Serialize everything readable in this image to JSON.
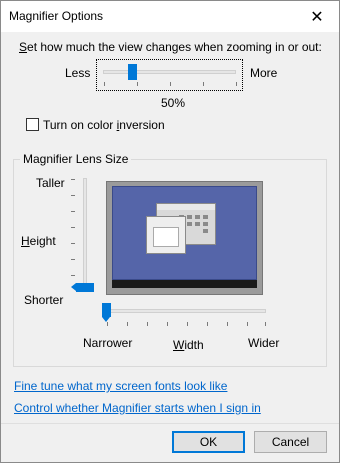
{
  "window": {
    "title": "Magnifier Options",
    "close_icon": "close-icon"
  },
  "zoom": {
    "label_pre": "",
    "label_underlined": "S",
    "label_post": "et how much the view changes when zooming in or out:",
    "less_label": "Less",
    "more_label": "More",
    "value_label": "50%",
    "slider_level_fraction": 0.25
  },
  "color_inversion": {
    "checked": false,
    "label_pre": "Turn on color ",
    "label_underlined": "i",
    "label_post": "nversion"
  },
  "lens_size": {
    "group_title": "Magnifier Lens Size",
    "taller_label": "Taller",
    "height_label_underlined": "H",
    "height_label_rest": "eight",
    "shorter_label": "Shorter",
    "height_level_fraction": 0.0,
    "narrower_label": "Narrower",
    "width_label_underlined": "W",
    "width_label_rest": "idth",
    "wider_label": "Wider",
    "width_level_fraction": 0.0
  },
  "links": {
    "fonts_link": "Fine tune what my screen fonts look like",
    "startup_link": "Control whether Magnifier starts when I sign in"
  },
  "buttons": {
    "ok_label": "OK",
    "cancel_label": "Cancel"
  },
  "colors": {
    "accent": "#0078d7",
    "link": "#0066cc",
    "preview_desktop": "#5565a9"
  }
}
